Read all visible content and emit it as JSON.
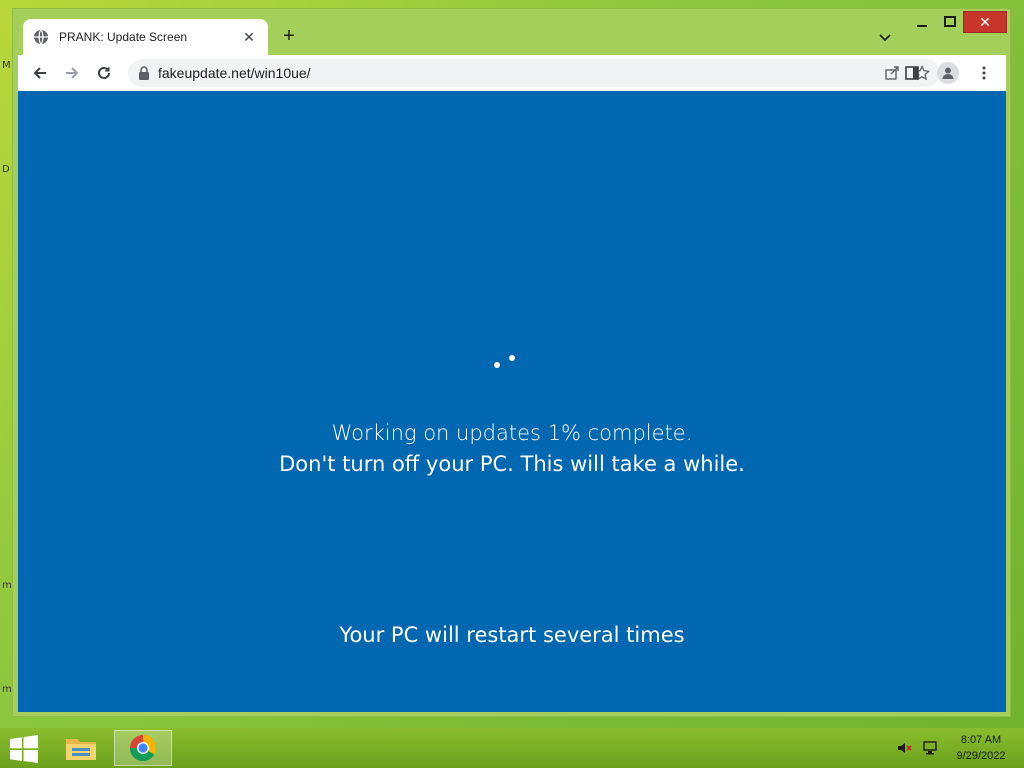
{
  "desktop": {
    "edge_letters": [
      "M",
      "D",
      "m",
      "m"
    ]
  },
  "browser": {
    "tab": {
      "title": "PRANK: Update Screen",
      "icon": "globe-icon"
    },
    "url": "fakeupdate.net/win10ue/"
  },
  "page": {
    "progress_percent": 1,
    "line1": "Working on updates  1% complete.",
    "line2": "Don't turn off your PC. This will take a while.",
    "line3": "Your PC will restart several times",
    "background_color": "#0067b0"
  },
  "taskbar": {
    "time": "8:07 AM",
    "date": "9/29/2022"
  }
}
